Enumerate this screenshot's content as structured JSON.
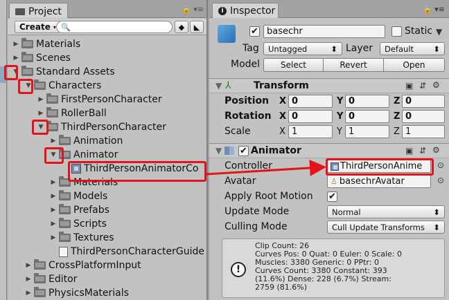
{
  "project": {
    "tab_label": "Project",
    "create_label": "Create",
    "search_placeholder": "",
    "tree": [
      {
        "label": "Materials",
        "indent": 0,
        "expanded": false
      },
      {
        "label": "Scenes",
        "indent": 0,
        "expanded": false
      },
      {
        "label": "Standard Assets",
        "indent": 0,
        "expanded": true
      },
      {
        "label": "Characters",
        "indent": 1,
        "expanded": true
      },
      {
        "label": "FirstPersonCharacter",
        "indent": 2,
        "expanded": false
      },
      {
        "label": "RollerBall",
        "indent": 2,
        "expanded": false
      },
      {
        "label": "ThirdPersonCharacter",
        "indent": 2,
        "expanded": true
      },
      {
        "label": "Animation",
        "indent": 3,
        "expanded": false
      },
      {
        "label": "Animator",
        "indent": 3,
        "expanded": true
      },
      {
        "label": "ThirdPersonAnimatorCo",
        "indent": 4,
        "type": "controller"
      },
      {
        "label": "Materials",
        "indent": 3,
        "expanded": false
      },
      {
        "label": "Models",
        "indent": 3,
        "expanded": false
      },
      {
        "label": "Prefabs",
        "indent": 3,
        "expanded": false
      },
      {
        "label": "Scripts",
        "indent": 3,
        "expanded": false
      },
      {
        "label": "Textures",
        "indent": 3,
        "expanded": false
      },
      {
        "label": "ThirdPersonCharacterGuide",
        "indent": 3,
        "type": "file"
      },
      {
        "label": "CrossPlatformInput",
        "indent": 1,
        "expanded": false
      },
      {
        "label": "Editor",
        "indent": 1,
        "expanded": false
      },
      {
        "label": "PhysicsMaterials",
        "indent": 1,
        "expanded": false
      }
    ]
  },
  "inspector": {
    "tab_label": "Inspector",
    "object_name": "basechr",
    "static_label": "Static",
    "tag_label": "Tag",
    "tag_value": "Untagged",
    "layer_label": "Layer",
    "layer_value": "Default",
    "model_label": "Model",
    "select_label": "Select",
    "revert_label": "Revert",
    "open_label": "Open",
    "transform": {
      "title": "Transform",
      "position_label": "Position",
      "rotation_label": "Rotation",
      "scale_label": "Scale",
      "x": "X",
      "y": "Y",
      "z": "Z",
      "position": [
        "0",
        "0",
        "0"
      ],
      "rotation": [
        "0",
        "0",
        "0"
      ],
      "scale": [
        "1",
        "1",
        "1"
      ]
    },
    "animator": {
      "title": "Animator",
      "controller_label": "Controller",
      "controller_value": "ThirdPersonAnime",
      "avatar_label": "Avatar",
      "avatar_value": "basechrAvatar",
      "apply_root_motion_label": "Apply Root Motion",
      "update_mode_label": "Update Mode",
      "update_mode_value": "Normal",
      "culling_mode_label": "Culling Mode",
      "culling_mode_value": "Cull Update Transforms",
      "info": "Clip Count: 26\nCurves Pos: 0 Quat: 0 Euler: 0 Scale: 0\nMuscles: 3380 Generic: 0 PPtr: 0\nCurves Count: 3380 Constant: 393\n(11.6%) Dense: 228 (6.7%) Stream:\n2759 (81.6%)"
    }
  },
  "colors": {
    "highlight": "#e4131a",
    "panel": "#c2c2c2"
  }
}
